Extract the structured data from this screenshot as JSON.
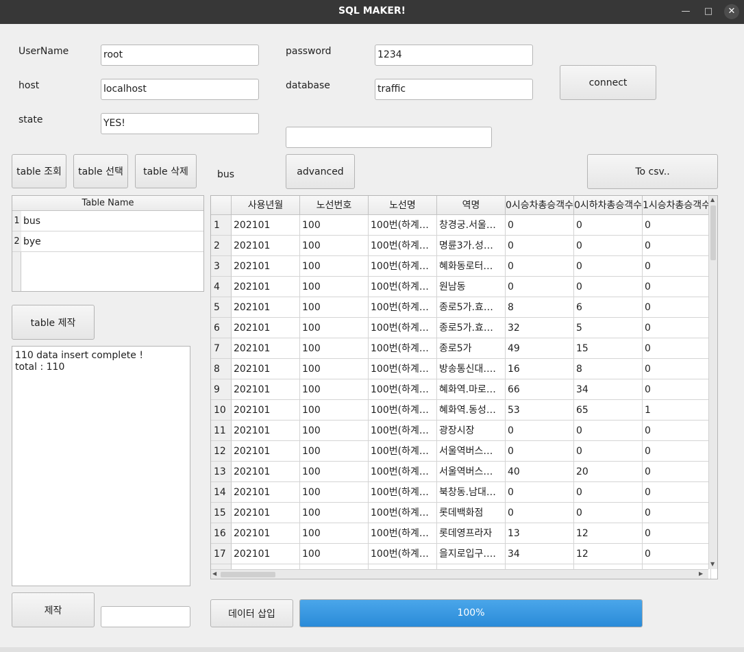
{
  "window": {
    "title": "SQL MAKER!"
  },
  "form": {
    "username_label": "UserName",
    "username_value": "root",
    "password_label": "password",
    "password_value": "1234",
    "host_label": "host",
    "host_value": "localhost",
    "database_label": "database",
    "database_value": "traffic",
    "state_label": "state",
    "state_value": "YES!",
    "query_value": "",
    "connect_label": "connect"
  },
  "toolbar": {
    "table_view": "table 조회",
    "table_select": "table 선택",
    "table_delete": "table 삭제",
    "selected_table": "bus",
    "advanced": "advanced",
    "to_csv": "To csv.."
  },
  "table_list": {
    "header": "Table Name",
    "rows": [
      {
        "num": "1",
        "name": "bus"
      },
      {
        "num": "2",
        "name": "bye"
      }
    ]
  },
  "create_table_button": "table 제작",
  "log": {
    "text": "110 data insert complete !\ntotal : 110"
  },
  "make_button": "제작",
  "make_input_value": "",
  "insert_button": "데이터 삽입",
  "progress": {
    "value": 100,
    "text": "100%",
    "color": "#2f8fdb"
  },
  "grid": {
    "columns": [
      "사용년월",
      "노선번호",
      "노선명",
      "역명",
      "0시승차총승객수",
      "0시하차총승객수",
      "1시승차총승객수"
    ],
    "rows": [
      [
        "1",
        "202101",
        "100",
        "100번(하계…",
        "창경궁.서울…",
        "0",
        "0",
        "0"
      ],
      [
        "2",
        "202101",
        "100",
        "100번(하계…",
        "명륜3가.성…",
        "0",
        "0",
        "0"
      ],
      [
        "3",
        "202101",
        "100",
        "100번(하계…",
        "혜화동로터…",
        "0",
        "0",
        "0"
      ],
      [
        "4",
        "202101",
        "100",
        "100번(하계…",
        "원남동",
        "0",
        "0",
        "0"
      ],
      [
        "5",
        "202101",
        "100",
        "100번(하계…",
        "종로5가.효…",
        "8",
        "6",
        "0"
      ],
      [
        "6",
        "202101",
        "100",
        "100번(하계…",
        "종로5가.효…",
        "32",
        "5",
        "0"
      ],
      [
        "7",
        "202101",
        "100",
        "100번(하계…",
        "종로5가",
        "49",
        "15",
        "0"
      ],
      [
        "8",
        "202101",
        "100",
        "100번(하계…",
        "방송통신대….",
        "16",
        "8",
        "0"
      ],
      [
        "9",
        "202101",
        "100",
        "100번(하계…",
        "혜화역.마로…",
        "66",
        "34",
        "0"
      ],
      [
        "10",
        "202101",
        "100",
        "100번(하계…",
        "혜화역.동성…",
        "53",
        "65",
        "1"
      ],
      [
        "11",
        "202101",
        "100",
        "100번(하계…",
        "광장시장",
        "0",
        "0",
        "0"
      ],
      [
        "12",
        "202101",
        "100",
        "100번(하계…",
        "서울역버스…",
        "0",
        "0",
        "0"
      ],
      [
        "13",
        "202101",
        "100",
        "100번(하계…",
        "서울역버스…",
        "40",
        "20",
        "0"
      ],
      [
        "14",
        "202101",
        "100",
        "100번(하계…",
        "북창동.남대…",
        "0",
        "0",
        "0"
      ],
      [
        "15",
        "202101",
        "100",
        "100번(하계…",
        "롯데백화점",
        "0",
        "0",
        "0"
      ],
      [
        "16",
        "202101",
        "100",
        "100번(하계…",
        "롯데영프라자",
        "13",
        "12",
        "0"
      ],
      [
        "17",
        "202101",
        "100",
        "100번(하계…",
        "을지로입구….",
        "34",
        "12",
        "0"
      ]
    ]
  }
}
